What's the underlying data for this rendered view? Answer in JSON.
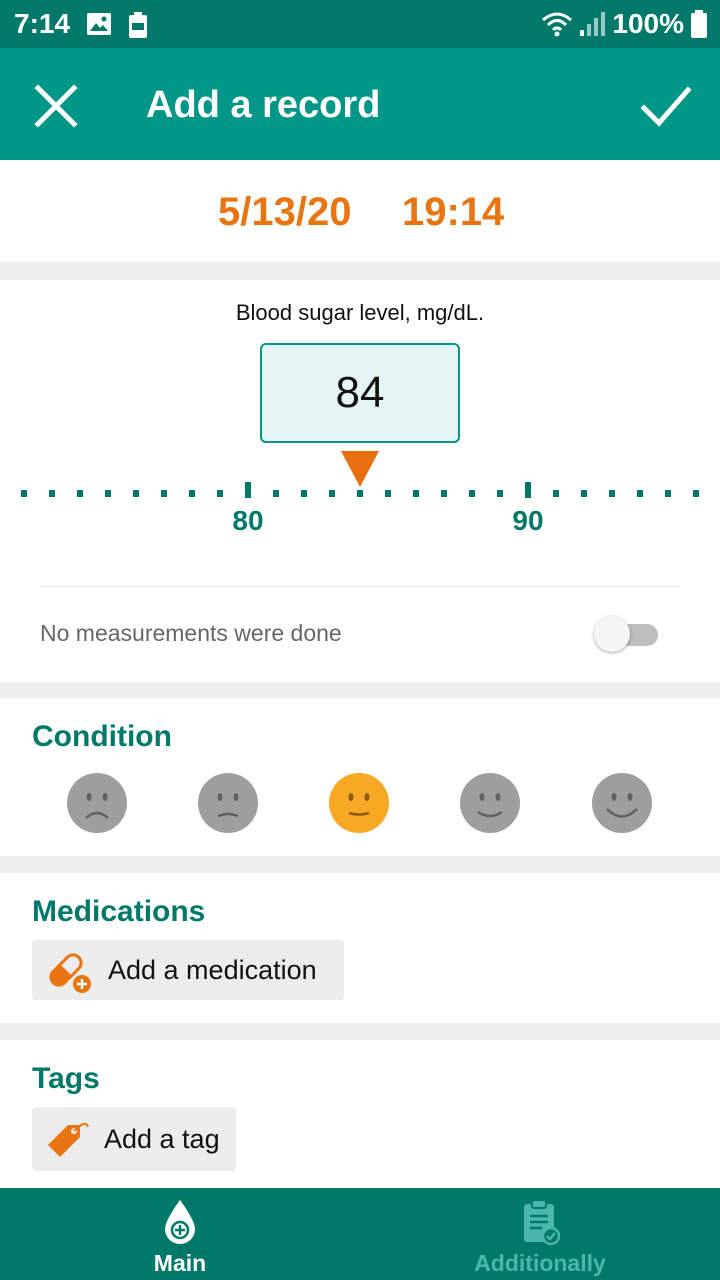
{
  "status_bar": {
    "time": "7:14",
    "battery_text": "100%"
  },
  "app_bar": {
    "title": "Add a record"
  },
  "record": {
    "date": "5/13/20",
    "time": "19:14"
  },
  "blood_sugar": {
    "label": "Blood sugar level, mg/dL.",
    "value": "84",
    "scale_labels": [
      "80",
      "90"
    ],
    "no_measurements_label": "No measurements were done",
    "no_measurements_enabled": false
  },
  "condition": {
    "title": "Condition",
    "faces": [
      {
        "icon": "very-sad-face-icon",
        "selected": false
      },
      {
        "icon": "sad-face-icon",
        "selected": false
      },
      {
        "icon": "neutral-face-icon",
        "selected": true
      },
      {
        "icon": "happy-face-icon",
        "selected": false
      },
      {
        "icon": "very-happy-face-icon",
        "selected": false
      }
    ]
  },
  "medications": {
    "title": "Medications",
    "add_label": "Add a medication"
  },
  "tags": {
    "title": "Tags",
    "add_label": "Add a tag"
  },
  "bottom_nav": {
    "main_label": "Main",
    "additionally_label": "Additionally"
  },
  "colors": {
    "primary": "#009688",
    "primary_dark": "#00796b",
    "accent": "#e87511"
  }
}
